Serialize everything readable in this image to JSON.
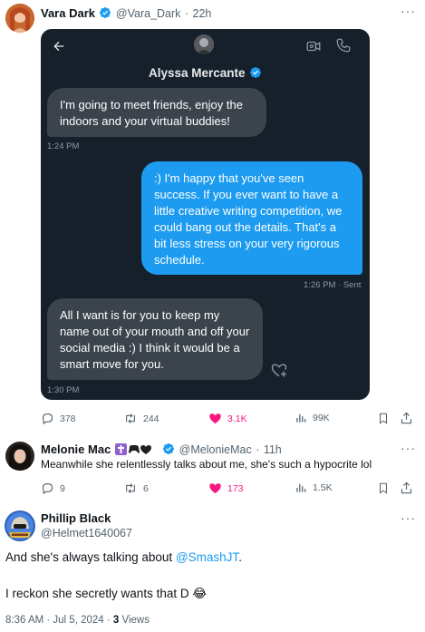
{
  "post1": {
    "author_name": "Vara Dark",
    "handle": "@Vara_Dark",
    "time": "22h",
    "dm": {
      "contact_name": "Alyssa Mercante",
      "messages": [
        {
          "dir": "in",
          "text": "I'm going to meet friends, enjoy the indoors and your virtual buddies!",
          "time": "1:24 PM"
        },
        {
          "dir": "out",
          "text": ":) I'm happy that you've seen success. If you ever want to have a little creative writing competition, we could bang out the details. That's a bit less stress on your very rigorous schedule.",
          "time": "1:26 PM · Sent"
        },
        {
          "dir": "in",
          "text": "All I want is for you to keep my name out of your mouth and off your social media :) I think it would be a smart move for you.",
          "time": "1:30 PM"
        }
      ]
    },
    "actions": {
      "replies": "378",
      "reposts": "244",
      "likes": "3.1K",
      "views": "99K"
    }
  },
  "post2": {
    "author_name": "Melonie Mac",
    "handle": "@MelonieMac",
    "time": "11h",
    "text": "Meanwhile she relentlessly talks about me, she's such a hypocrite lol",
    "actions": {
      "replies": "9",
      "reposts": "6",
      "likes": "173",
      "views": "1.5K"
    }
  },
  "post3": {
    "author_name": "Phillip Black",
    "handle": "@Helmet1640067",
    "text_before": "And she's always talking about ",
    "mention": "@SmashJT",
    "text_after": ".",
    "text2": "I reckon she secretly wants that D 😂",
    "meta_time": "8:36 AM · Jul 5, 2024 · ",
    "views_count": "3",
    "views_label": " Views"
  },
  "colors": {
    "accent": "#1d9bf0",
    "like": "#f91880",
    "dm_bg": "#15202b",
    "bubble_in": "#3b444d"
  },
  "icons": [
    "more-icon",
    "back-arrow-icon",
    "video-call-icon",
    "phone-icon",
    "verified-badge-icon",
    "reply-icon",
    "repost-icon",
    "heart-icon",
    "views-icon",
    "bookmark-icon",
    "share-icon",
    "react-heart-plus-icon"
  ]
}
